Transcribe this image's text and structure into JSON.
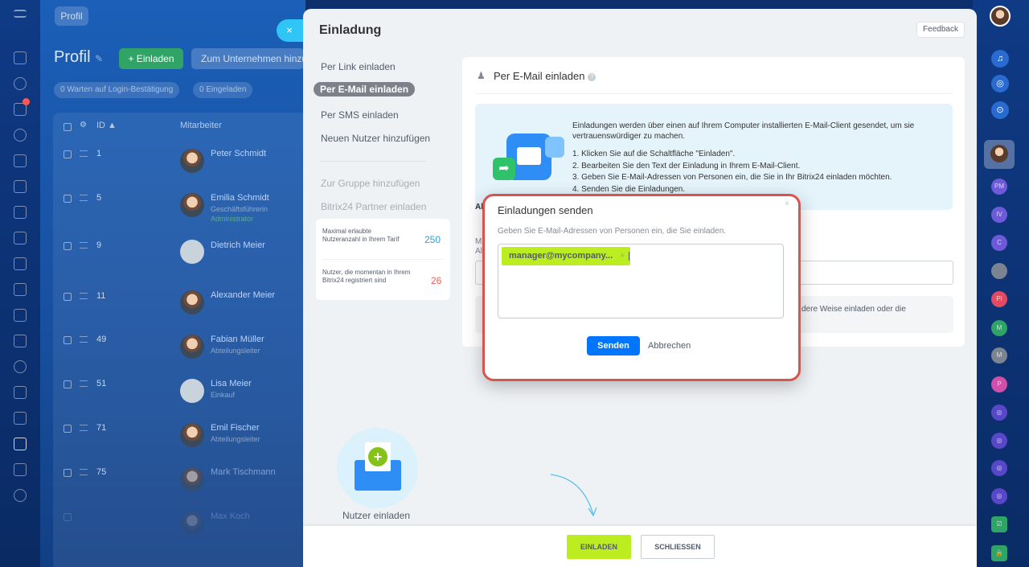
{
  "background": {
    "crumb": "Profil",
    "title": "Profil",
    "invite_button": "+ Einladen",
    "company_button": "Zum Unternehmen hinzufügen",
    "chips": [
      "0  Warten auf Login-Bestätigung",
      "0  Eingeladen"
    ],
    "columns": {
      "id": "ID",
      "employee": "Mitarbeiter"
    },
    "rows": [
      {
        "id": "1",
        "name": "Peter Schmidt",
        "role": ""
      },
      {
        "id": "5",
        "name": "Emilia Schmidt",
        "role": "Geschäftsführerin",
        "role2": "Administrator"
      },
      {
        "id": "9",
        "name": "Dietrich Meier",
        "role": ""
      },
      {
        "id": "11",
        "name": "Alexander Meier",
        "role": ""
      },
      {
        "id": "49",
        "name": "Fabian Müller",
        "role": "Abteilungsleiter"
      },
      {
        "id": "51",
        "name": "Lisa Meier",
        "role": "Einkauf"
      },
      {
        "id": "71",
        "name": "Emil Fischer",
        "role": "Abteilungsleiter"
      },
      {
        "id": "75",
        "name": "Mark Tischmann",
        "role": ""
      },
      {
        "id": "",
        "name": "Max Koch",
        "role": ""
      }
    ]
  },
  "right_rail": {
    "avatars": [
      "PM",
      "IV",
      "C",
      "PI",
      "M",
      "M",
      "P"
    ]
  },
  "slider": {
    "close": "×",
    "title": "Einladung",
    "feedback": "Feedback",
    "menu": {
      "link": "Per Link einladen",
      "email": "Per E-Mail einladen",
      "sms": "Per SMS einladen",
      "new_user": "Neuen Nutzer hinzufügen",
      "group": "Zur Gruppe hinzufügen",
      "partner": "Bitrix24 Partner einladen"
    },
    "limits": {
      "max_label": "Maximal erlaubte Nutzeranzahl in Ihrem Tarif",
      "max_value": "250",
      "current_label": "Nutzer, die momentan in Ihrem Bitrix24 registriert sind",
      "current_value": "26"
    },
    "card": {
      "title": "Per E-Mail einladen",
      "info_intro": "Einladungen werden über einen auf Ihrem Computer installierten E-Mail-Client gesendet, um sie vertrauenswürdiger zu machen.",
      "steps": [
        "1. Klicken Sie auf die Schaltfläche \"Einladen\".",
        "2. Bearbeiten Sie den Text der Einladung in Ihrem E-Mail-Client.",
        "3. Geben Sie E-Mail-Adressen von Personen ein, die Sie in Ihr Bitrix24 einladen möchten.",
        "4. Senden Sie die Einladungen."
      ],
      "partial_left_1": "Al",
      "partial_left_2": "M",
      "partial_left_3": "Al",
      "hint_right": "dere Weise einladen oder die"
    },
    "illustration_label": "Nutzer einladen",
    "footer": {
      "invite": "EINLADEN",
      "close": "SCHLIESSEN"
    }
  },
  "popup": {
    "title": "Einladungen senden",
    "close": "×",
    "description": "Geben Sie E-Mail-Adressen von Personen ein, die Sie einladen.",
    "tag": "manager@mycompany...",
    "tag_remove": "×",
    "send": "Senden",
    "cancel": "Abbrechen"
  },
  "colors": {
    "accent_blue": "#0075ff",
    "green_button": "#bbed21",
    "highlight_border": "#d9534f"
  }
}
